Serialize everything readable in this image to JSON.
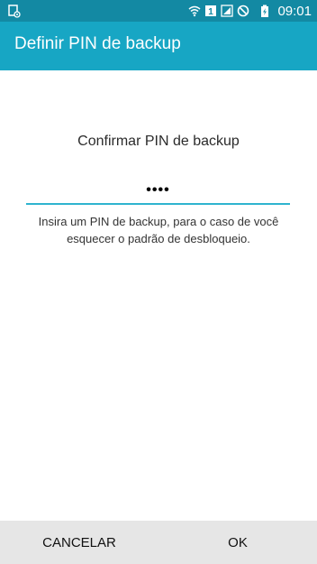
{
  "status_bar": {
    "time": "09:01",
    "sim_label": "1",
    "icons": [
      "screenshot-icon",
      "wifi-icon",
      "sim-icon",
      "signal-icon",
      "no-disturb-icon",
      "battery-charging-icon"
    ]
  },
  "app_bar": {
    "title": "Definir PIN de backup"
  },
  "main": {
    "prompt_title": "Confirmar PIN de backup",
    "pin_value": "••••",
    "hint": "Insira um PIN de backup, para o caso de você esquecer o padrão de desbloqueio."
  },
  "bottom_bar": {
    "cancel_label": "CANCELAR",
    "ok_label": "OK"
  },
  "colors": {
    "status_bar": "#1389a3",
    "app_bar": "#17a6c4",
    "accent_underline": "#2fb4cf",
    "bottom_bar": "#e6e6e6"
  }
}
